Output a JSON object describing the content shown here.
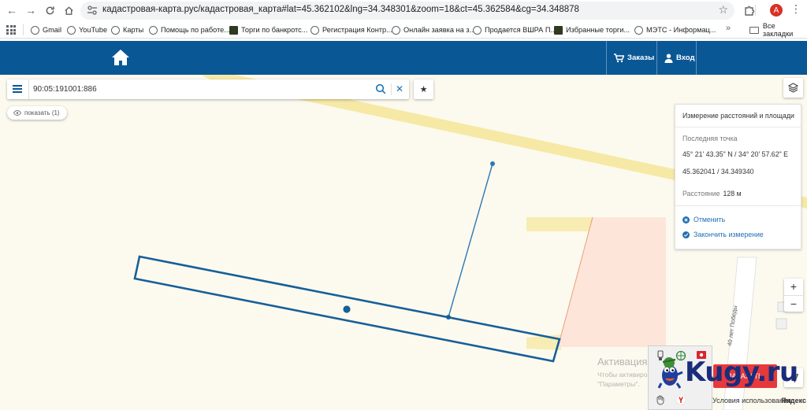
{
  "browser": {
    "url": "кадастровая-карта.рус/кадастровая_карта#lat=45.362102&lng=34.348301&zoom=18&ct=45.362584&cg=34.348878",
    "avatar_letter": "A",
    "bookmarks": [
      {
        "label": "Gmail",
        "icon": "globe-icon"
      },
      {
        "label": "YouTube",
        "icon": "globe-icon"
      },
      {
        "label": "Карты",
        "icon": "globe-icon"
      },
      {
        "label": "Помощь по работе...",
        "icon": "globe-icon"
      },
      {
        "label": "Торги по банкротс...",
        "icon": "torgi-icon"
      },
      {
        "label": "Регистрация Контр...",
        "icon": "globe-icon"
      },
      {
        "label": "Онлайн заявка на з...",
        "icon": "globe-icon"
      },
      {
        "label": "Продается ВШРА П...",
        "icon": "globe-icon"
      },
      {
        "label": "Избранные торги...",
        "icon": "torgi-icon"
      },
      {
        "label": "МЭТС - Информац...",
        "icon": "globe-icon"
      }
    ],
    "bookmarks_more": "»",
    "all_bookmarks": "Все закладки"
  },
  "header": {
    "orders_label": "Заказы",
    "login_label": "Вход",
    "color": "#0a5796"
  },
  "search": {
    "value": "90:05:191001:886",
    "placeholder": ""
  },
  "show_chip": {
    "label": "показать (1)"
  },
  "measure": {
    "title": "Измерение расстояний и площади",
    "last_point_label": "Последняя точка",
    "dms": "45° 21' 43.35\" N / 34° 20' 57.62\" E",
    "decimal": "45.362041 / 34.349340",
    "distance_label": "Расстояние",
    "distance_value": "128 м",
    "cancel_label": "Отменить",
    "finish_label": "Закончить измерение"
  },
  "map_labels": {
    "street": "40 лет Победы"
  },
  "overlay": {
    "activation_title": "Активация Windows",
    "activation_line1": "Чтобы активировать Windows, перейдите в раздел",
    "activation_line2": "\"Параметры\".",
    "red_button": "ЗАКАЗАТЬ",
    "watermark": "Kugy.ru"
  },
  "footer": {
    "terms": "Условия использования",
    "yandex": "Яндекс"
  },
  "colors": {
    "parcel_outline": "#175f9a",
    "road": "#f6e9a6",
    "pink_parcel": "#fde5da",
    "accent": "#1f6fb6",
    "red_button": "#e6393c"
  }
}
